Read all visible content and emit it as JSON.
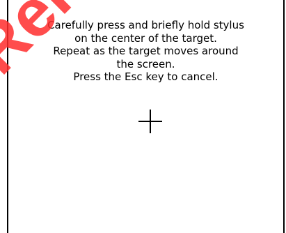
{
  "calibration": {
    "instructions": [
      "Carefully press and briefly hold stylus",
      "on the center of the target.",
      "Repeat as the target moves around",
      "the screen.",
      "Press the Esc key to cancel."
    ],
    "target_icon": "crosshair-icon"
  },
  "watermark": {
    "text": "Rele",
    "color": "#ff2d2d"
  }
}
